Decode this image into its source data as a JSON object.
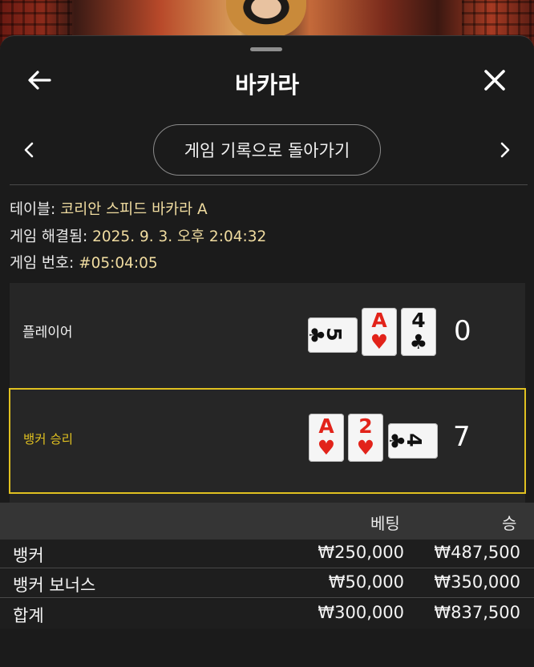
{
  "header": {
    "title": "바카라"
  },
  "nav": {
    "history_button_label": "게임 기록으로 돌아가기"
  },
  "info": {
    "table_label": "테이블:",
    "table_value": "코리안 스피드 바카라 A",
    "resolved_label": "게임 해결됨:",
    "resolved_value": "2025. 9. 3. 오후 2:04:32",
    "game_no_label": "게임 번호:",
    "game_no_value": "#05:04:05"
  },
  "player": {
    "label": "플레이어",
    "score": "0",
    "cards": [
      {
        "rank": "5",
        "suit": "♣",
        "color": "black",
        "orientation": "sideways"
      },
      {
        "rank": "A",
        "suit": "♥",
        "color": "red",
        "orientation": "upright"
      },
      {
        "rank": "4",
        "suit": "♣",
        "color": "black",
        "orientation": "upright"
      }
    ]
  },
  "banker": {
    "label": "뱅커 승리",
    "score": "7",
    "cards": [
      {
        "rank": "A",
        "suit": "♥",
        "color": "red",
        "orientation": "upright"
      },
      {
        "rank": "2",
        "suit": "♥",
        "color": "red",
        "orientation": "upright"
      },
      {
        "rank": "4",
        "suit": "♣",
        "color": "black",
        "orientation": "sideways"
      }
    ]
  },
  "bets_table": {
    "headers": {
      "bet": "베팅",
      "win": "승"
    },
    "rows": [
      {
        "name": "뱅커",
        "bet": "₩250,000",
        "win": "₩487,500"
      },
      {
        "name": "뱅커 보너스",
        "bet": "₩50,000",
        "win": "₩350,000"
      }
    ],
    "total": {
      "name": "합계",
      "bet": "₩300,000",
      "win": "₩837,500"
    }
  },
  "colors": {
    "accent_yellow": "#e0c020",
    "info_value": "#f0dca0",
    "card_red": "#e2231a"
  }
}
